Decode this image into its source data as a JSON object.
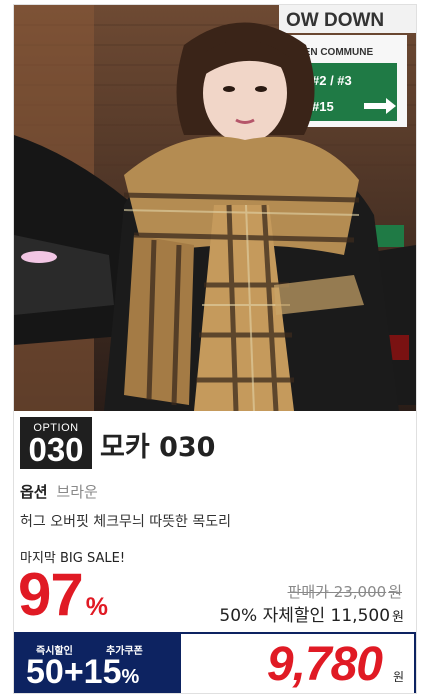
{
  "photo": {
    "sign_top": "OW DOWN",
    "sign_mid": "VEN COMMUNE",
    "sign_nums": "#2 / #3",
    "sign_num2": "#15"
  },
  "product": {
    "option_label": "OPTION",
    "option_number": "030",
    "name": "모카 030",
    "option_key": "옵션",
    "option_value": "브라운",
    "description": "허그 오버핏 체크무늬 따뜻한 목도리"
  },
  "sale": {
    "tag": "마지막 BIG SALE!",
    "discount_percent": "97",
    "percent_sign": "%",
    "original_price_label": "판매가 23,000",
    "original_price_unit": "원",
    "self_discount_label": "50% 자체할인 11,500",
    "self_discount_unit": "원"
  },
  "coupon": {
    "label_instant": "즉시할인",
    "label_extra": "추가쿠폰",
    "value": "50+15",
    "percent_sign": "%"
  },
  "final_price": {
    "value": "9,780",
    "unit": "원"
  },
  "colors": {
    "accent_red": "#e01a24",
    "navy": "#0d2361",
    "badge_black": "#1f1f1f"
  }
}
